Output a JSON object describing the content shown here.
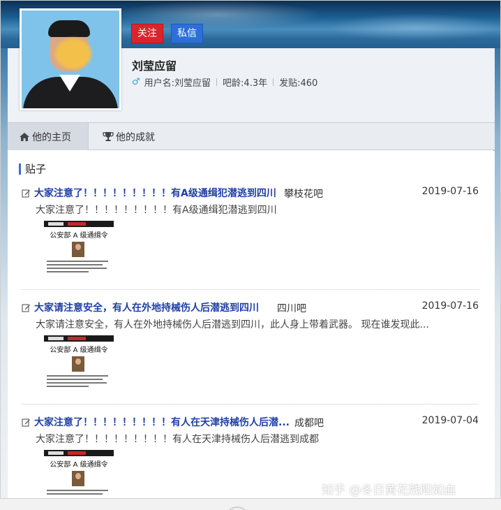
{
  "profile": {
    "follow_label": "关注",
    "message_label": "私信",
    "name": "刘莹应留",
    "username_label": "用户名:刘莹应留",
    "age_label": "吧龄:4.3年",
    "posts_label": "发贴:460",
    "gender_icon": "male-icon"
  },
  "tabs": {
    "home_label": "他的主页",
    "achievements_label": "他的成就"
  },
  "section": {
    "title": "贴子"
  },
  "posts": [
    {
      "title": "大家注意了！！！！！！！！！有A级通缉犯潜逃到四川",
      "forum": "攀枝花吧",
      "date": "2019-07-16",
      "excerpt": "大家注意了！！！！！！！！！有A级通缉犯潜逃到四川",
      "thumb_title": "公安部 A 级通缉令"
    },
    {
      "title": "大家请注意安全，有人在外地持械伤人后潜逃到四川",
      "forum": "四川吧",
      "date": "2019-07-16",
      "excerpt": "大家请注意安全，有人在外地持械伤人后潜逃到四川，此人身上带着武器。 现在谁发现此...",
      "thumb_title": "公安部 A 级通缉令"
    },
    {
      "title": "大家注意了！！！！！！！！！有人在天津持械伤人后潜...",
      "forum": "成都吧",
      "date": "2019-07-04",
      "excerpt": "大家注意了！！！！！！！！！有人在天津持械伤人后潜逃到成都",
      "thumb_title": "公安部 A 级通缉令"
    }
  ],
  "watermark": {
    "text": "知乎 @冬日黄花残阳如血"
  },
  "colors": {
    "follow": "#d9262b",
    "message": "#2d6fd8",
    "link": "#1f3fa5",
    "accent": "#3a6fd0"
  }
}
